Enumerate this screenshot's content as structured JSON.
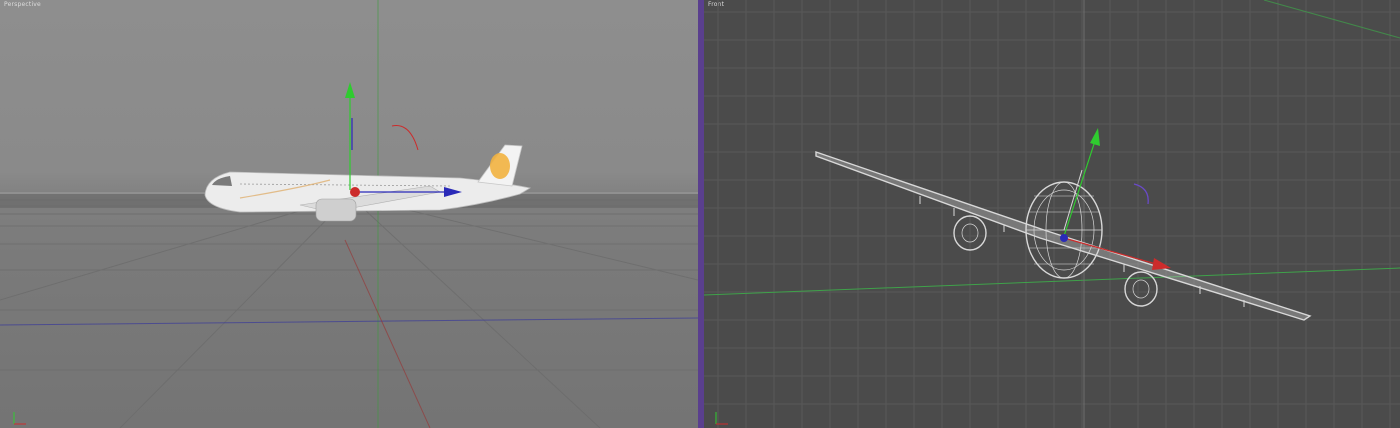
{
  "viewports": {
    "left": {
      "label": "Perspective"
    },
    "right": {
      "label": "Front"
    }
  },
  "colors": {
    "viewport_left_bg": "#8a8a8a",
    "viewport_right_bg": "#4b4b4b",
    "divider": "#5a3f8e",
    "axis_x": "#cc2b2b",
    "axis_y": "#2fcc2f",
    "axis_z": "#2a2ab8",
    "airplane_body": "#ececec",
    "tail_logo": "#f2b340",
    "wireframe": "#d8d8d8"
  },
  "icons": [
    "move-axis-y-icon",
    "move-axis-x-icon",
    "move-axis-z-icon",
    "rotation-arc-icon",
    "world-axis-icon"
  ]
}
